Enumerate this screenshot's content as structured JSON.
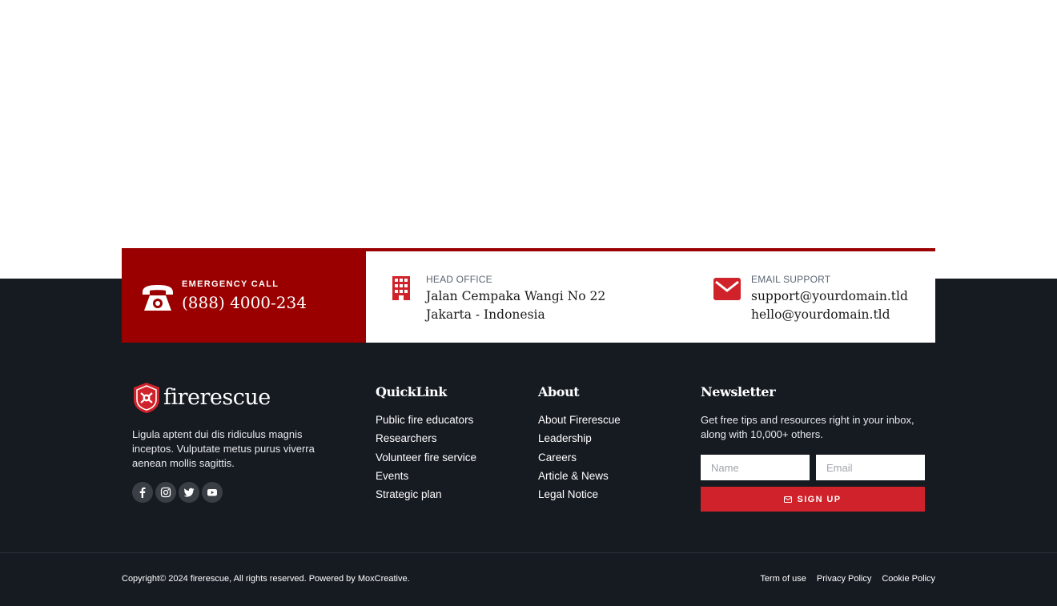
{
  "contact": {
    "emergency": {
      "label": "EMERGENCY CALL",
      "phone": "(888) 4000-234",
      "icon": "phone-icon"
    },
    "office": {
      "label": "HEAD OFFICE",
      "line1": "Jalan Cempaka Wangi No 22",
      "line2": "Jakarta - Indonesia",
      "icon": "building-icon"
    },
    "email": {
      "label": "EMAIL SUPPORT",
      "line1": "support@yourdomain.tld",
      "line2": "hello@yourdomain.tld",
      "icon": "envelope-icon"
    }
  },
  "brand": {
    "name": "firerescue",
    "description": "Ligula aptent dui dis ridiculus magnis inceptos. Vulputate metus purus viverra aenean mollis sagittis.",
    "socials": [
      "facebook-icon",
      "instagram-icon",
      "twitter-icon",
      "youtube-icon"
    ]
  },
  "quicklink": {
    "title": "QuickLink",
    "items": [
      "Public fire educators",
      "Researchers",
      "Volunteer fire service",
      "Events",
      "Strategic plan"
    ]
  },
  "about": {
    "title": "About",
    "items": [
      "About Firerescue",
      "Leadership",
      "Careers",
      "Article & News",
      "Legal Notice"
    ]
  },
  "newsletter": {
    "title": "Newsletter",
    "description": "Get free tips and resources right in your inbox, along with 10,000+ others.",
    "name_placeholder": "Name",
    "email_placeholder": "Email",
    "button_label": "SIGN UP"
  },
  "bottom": {
    "copyright": "Copyright© 2024 firerescue, All rights reserved. Powered by MoxCreative.",
    "links": [
      "Term of use",
      "Privacy Policy",
      "Cookie Policy"
    ]
  },
  "colors": {
    "accent_dark_red": "#9a0000",
    "accent_red": "#d0222a",
    "footer_bg": "#161b22"
  }
}
